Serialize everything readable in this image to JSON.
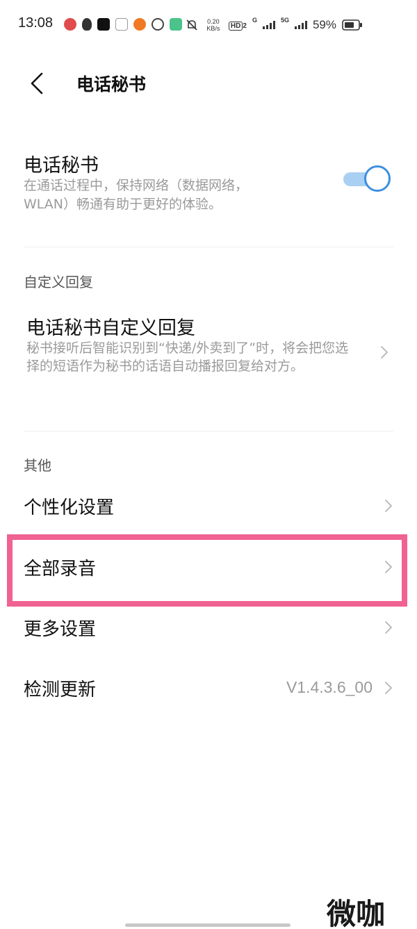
{
  "status_bar": {
    "time": "13:08",
    "net_speed_value": "0.20",
    "net_speed_unit": "KB/s",
    "hd_label": "HD",
    "hd_sub": "2",
    "net1_label": "G",
    "net2_label": "5G",
    "battery_percent": "59%"
  },
  "header": {
    "title": "电话秘书"
  },
  "secretary": {
    "title": "电话秘书",
    "description": "在通话过程中，保持网络（数据网络，WLAN）畅通有助于更好的体验。",
    "toggle_on": true
  },
  "custom_reply_section": {
    "label": "自定义回复",
    "item_title": "电话秘书自定义回复",
    "item_description": "秘书接听后智能识别到“快递/外卖到了”时，将会把您选择的短语作为秘书的话语自动播报回复给对方。"
  },
  "other_section": {
    "label": "其他",
    "items": [
      {
        "label": "个性化设置",
        "value": ""
      },
      {
        "label": "全部录音",
        "value": ""
      },
      {
        "label": "更多设置",
        "value": ""
      },
      {
        "label": "检测更新",
        "value": "V1.4.3.6_00"
      }
    ]
  },
  "watermark": "微咖",
  "colors": {
    "accent": "#3b8fe0",
    "highlight": "#f06292"
  }
}
